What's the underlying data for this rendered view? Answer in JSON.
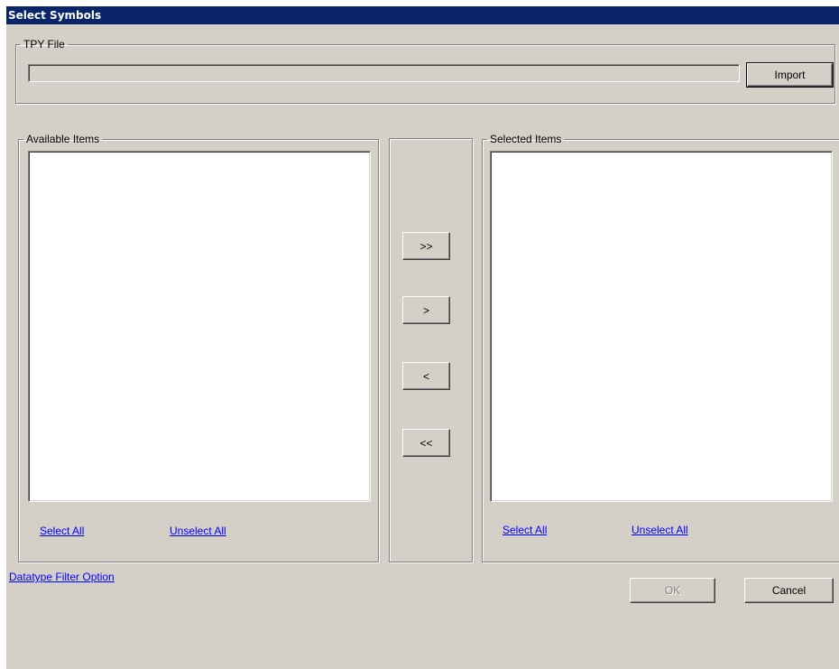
{
  "window": {
    "title": "Select Symbols"
  },
  "tpy_file": {
    "legend": "TPY File",
    "path_value": "",
    "import_label": "Import"
  },
  "available": {
    "legend": "Available Items",
    "items": [],
    "select_all_label": "Select All",
    "unselect_all_label": "Unselect All"
  },
  "transfer": {
    "add_all_label": ">>",
    "add_label": ">",
    "remove_label": "<",
    "remove_all_label": "<<"
  },
  "selected": {
    "legend": "Selected Items",
    "items": [],
    "select_all_label": "Select All",
    "unselect_all_label": "Unselect All"
  },
  "footer": {
    "datatype_filter_label": "Datatype Filter Option",
    "ok_label": "OK",
    "cancel_label": "Cancel"
  },
  "colors": {
    "titlebar": "#0a246a",
    "face": "#d4d0c8",
    "link": "#0000ff"
  }
}
